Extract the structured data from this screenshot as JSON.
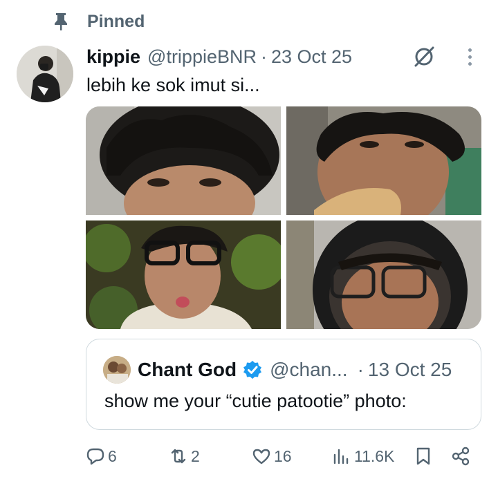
{
  "pinned": {
    "label": "Pinned",
    "icon": "pin-icon"
  },
  "tweet": {
    "display_name": "kippie",
    "handle": "@trippieBNR",
    "separator": "·",
    "timestamp": "23 Oct 25",
    "text": "lebih ke sok imut si...",
    "media_count": 4
  },
  "quote": {
    "display_name": "Chant God",
    "verified": true,
    "handle": "@chan...",
    "separator": "·",
    "timestamp": "13 Oct 25",
    "text": "show me your “cutie patootie” photo:"
  },
  "actions": {
    "replies": "6",
    "reposts": "2",
    "likes": "16",
    "views": "11.6K"
  },
  "colors": {
    "text_primary": "#0f1419",
    "text_secondary": "#536471",
    "verified_blue": "#1d9bf0",
    "border": "#cfd9de"
  }
}
